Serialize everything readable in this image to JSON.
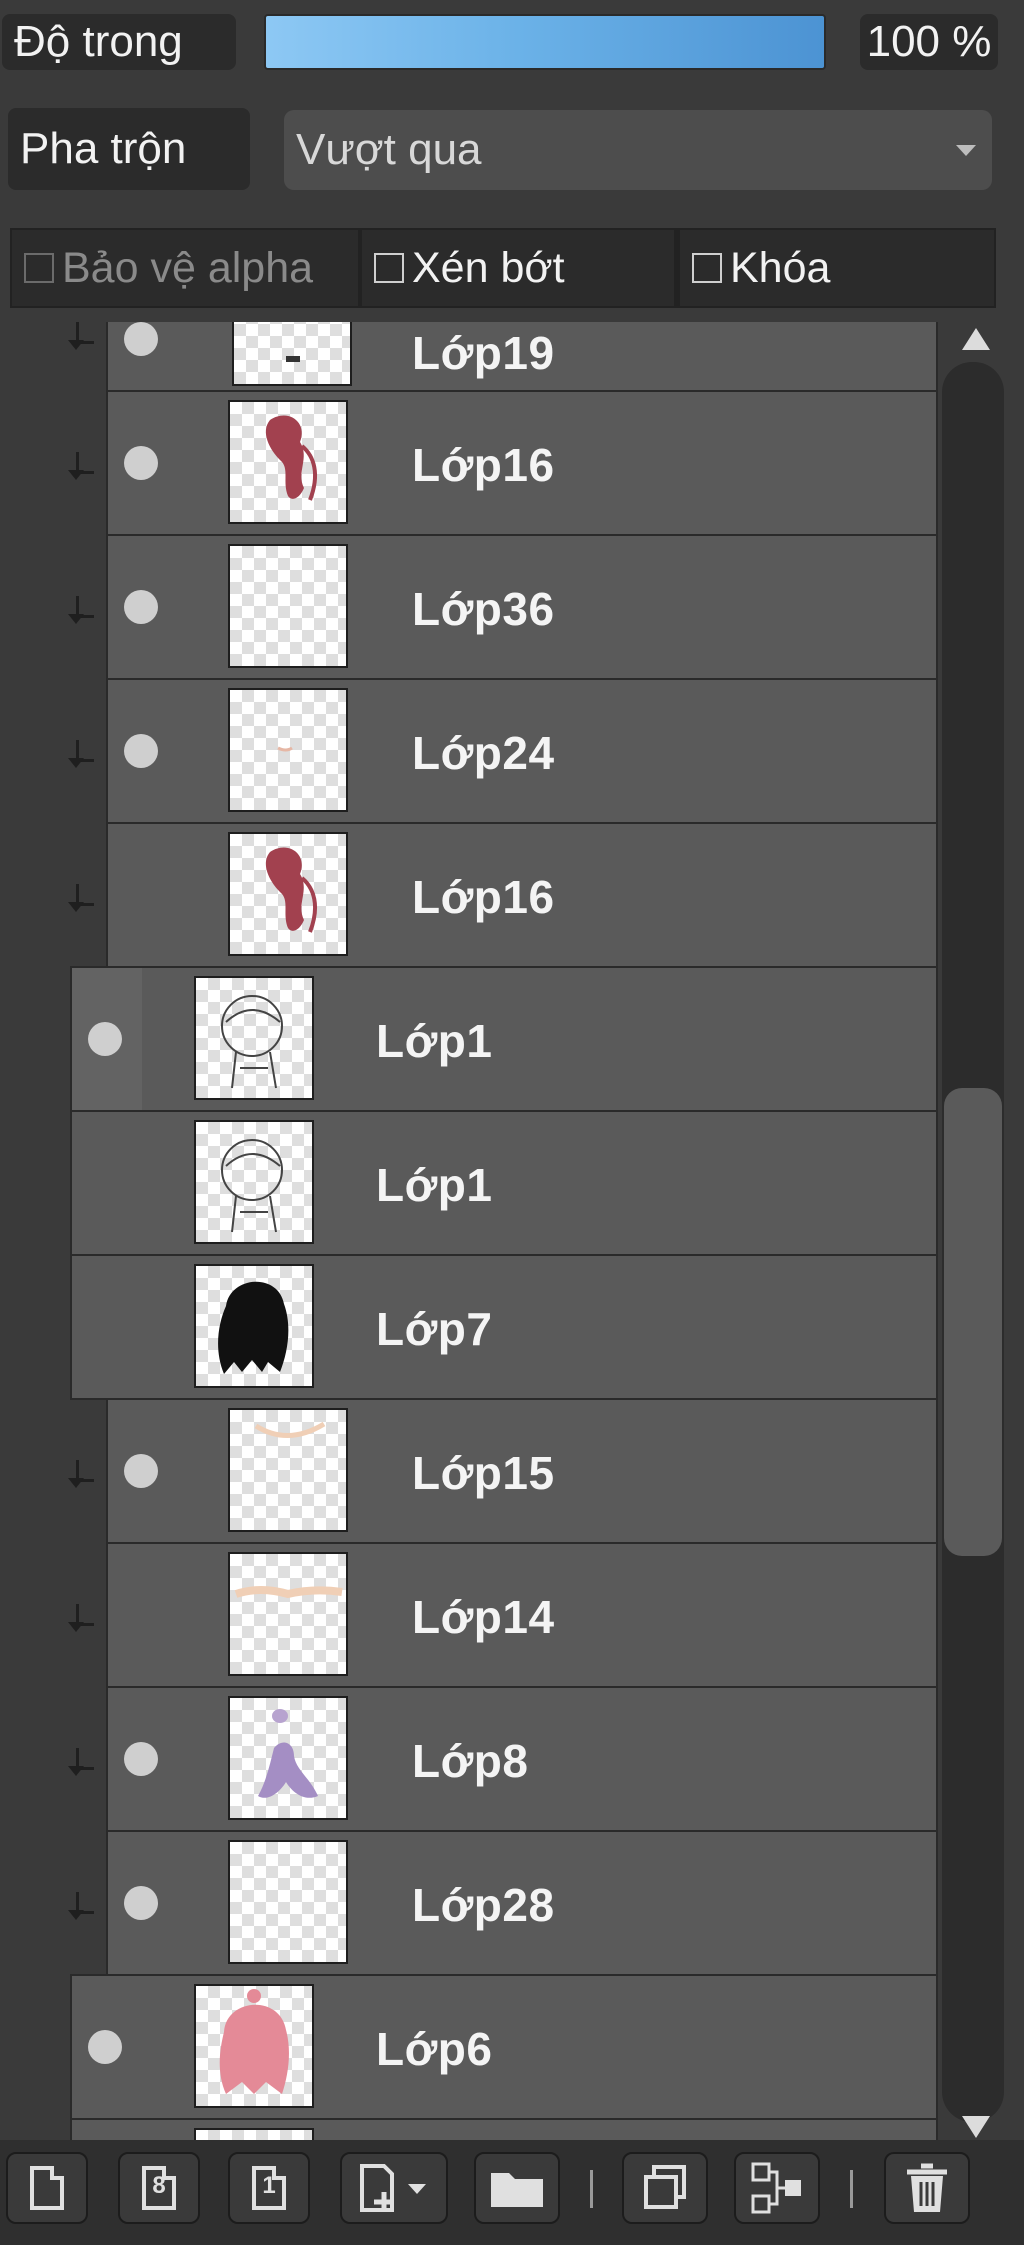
{
  "top": {
    "opacity_label": "Độ trong",
    "opacity_value": "100 %",
    "opacity_fraction": 1.0,
    "blend_label": "Pha trộn",
    "blend_mode": "Vượt qua",
    "protect_alpha": "Bảo vệ alpha",
    "clipping": "Xén bớt",
    "lock": "Khóa"
  },
  "layers": [
    {
      "name": "Lớp19",
      "visible": true
    },
    {
      "name": "Lớp16",
      "visible": true
    },
    {
      "name": "Lớp36",
      "visible": true
    },
    {
      "name": "Lớp24",
      "visible": true
    },
    {
      "name": "Lớp16",
      "visible": false
    },
    {
      "name": "Lớp1",
      "visible": true
    },
    {
      "name": "Lớp1",
      "visible": false
    },
    {
      "name": "Lớp7",
      "visible": false
    },
    {
      "name": "Lớp15",
      "visible": true
    },
    {
      "name": "Lớp14",
      "visible": false
    },
    {
      "name": "Lớp8",
      "visible": true
    },
    {
      "name": "Lớp28",
      "visible": true
    },
    {
      "name": "Lớp6",
      "visible": true
    }
  ],
  "toolbar": {
    "icons": [
      "new-layer-icon",
      "new-8bit-layer-icon",
      "new-1bit-layer-icon",
      "add-layer-menu-icon",
      "new-folder-icon",
      "duplicate-layer-icon",
      "merge-down-icon",
      "delete-layer-icon"
    ],
    "icon_8bit": "8",
    "icon_1bit": "1"
  },
  "colors": {
    "panel_bg": "#3a3a3a",
    "row_bg": "#5a5a5a",
    "accent_bar": "#6bb2e8"
  }
}
